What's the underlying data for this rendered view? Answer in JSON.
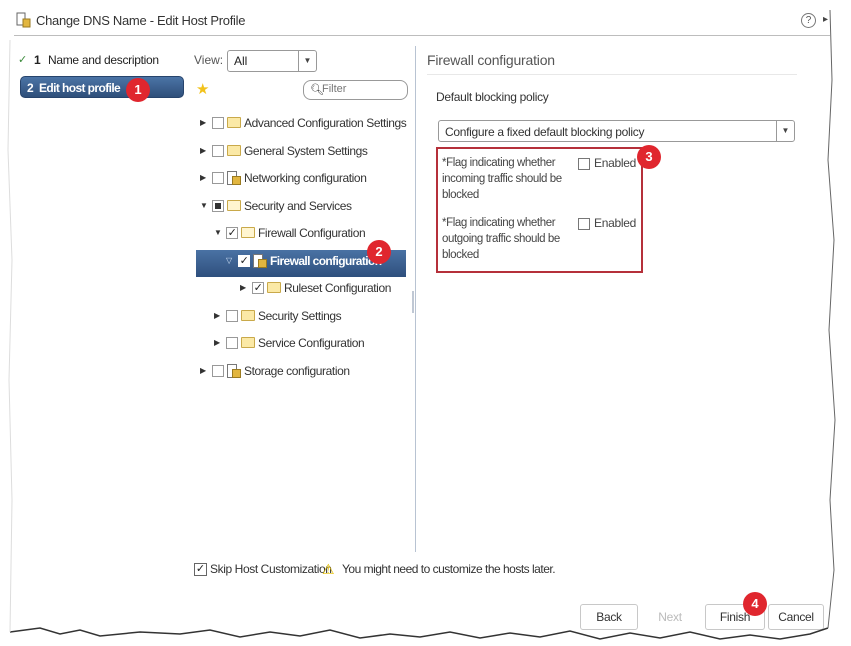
{
  "window": {
    "title": "Change DNS Name - Edit Host Profile",
    "help_icon": "?",
    "expand_icon": "▸"
  },
  "steps": [
    {
      "number": "1",
      "label": "Name and description",
      "completed": true,
      "active": false
    },
    {
      "number": "2",
      "label": "Edit host profile",
      "completed": false,
      "active": true
    }
  ],
  "tree_panel": {
    "view_label": "View:",
    "view_value": "All",
    "filter_placeholder": "Filter",
    "nodes": [
      {
        "label": "Advanced Configuration Settings",
        "level": 0,
        "expanded": false,
        "checked": "none",
        "icon": "folder-icon"
      },
      {
        "label": "General System Settings",
        "level": 0,
        "expanded": false,
        "checked": "none",
        "icon": "folder-icon"
      },
      {
        "label": "Networking configuration",
        "level": 0,
        "expanded": false,
        "checked": "none",
        "icon": "profile-icon"
      },
      {
        "label": "Security and Services",
        "level": 0,
        "expanded": true,
        "checked": "partial",
        "icon": "folder-open-icon"
      },
      {
        "label": "Firewall Configuration",
        "level": 1,
        "expanded": true,
        "checked": "checked",
        "icon": "folder-open-icon"
      },
      {
        "label": "Firewall configuration",
        "level": 2,
        "expanded": true,
        "checked": "checked",
        "icon": "profile-icon",
        "selected": true
      },
      {
        "label": "Ruleset Configuration",
        "level": 3,
        "expanded": false,
        "checked": "checked",
        "icon": "folder-icon"
      },
      {
        "label": "Security Settings",
        "level": 1,
        "expanded": false,
        "checked": "none",
        "icon": "folder-icon"
      },
      {
        "label": "Service Configuration",
        "level": 1,
        "expanded": false,
        "checked": "none",
        "icon": "folder-icon"
      },
      {
        "label": "Storage configuration",
        "level": 0,
        "expanded": false,
        "checked": "none",
        "icon": "profile-icon"
      }
    ]
  },
  "config_panel": {
    "title": "Firewall configuration",
    "policy_label": "Default blocking policy",
    "policy_value": "Configure a fixed default blocking policy",
    "flags": [
      {
        "description": "*Flag indicating whether incoming traffic should be blocked",
        "checkbox_label": "Enabled",
        "checked": false
      },
      {
        "description": "*Flag indicating whether outgoing traffic should be blocked",
        "checkbox_label": "Enabled",
        "checked": false
      }
    ]
  },
  "footer": {
    "skip_label": "Skip Host Customization",
    "skip_checked": true,
    "warning_text": "You might need to customize the hosts later.",
    "buttons": {
      "back": "Back",
      "next": "Next",
      "finish": "Finish",
      "cancel": "Cancel"
    }
  },
  "callouts": [
    "1",
    "2",
    "3",
    "4"
  ],
  "colors": {
    "accent_blue": "#3a5f8e",
    "callout_red": "#e0262e",
    "highlight_border": "#b5303a"
  }
}
